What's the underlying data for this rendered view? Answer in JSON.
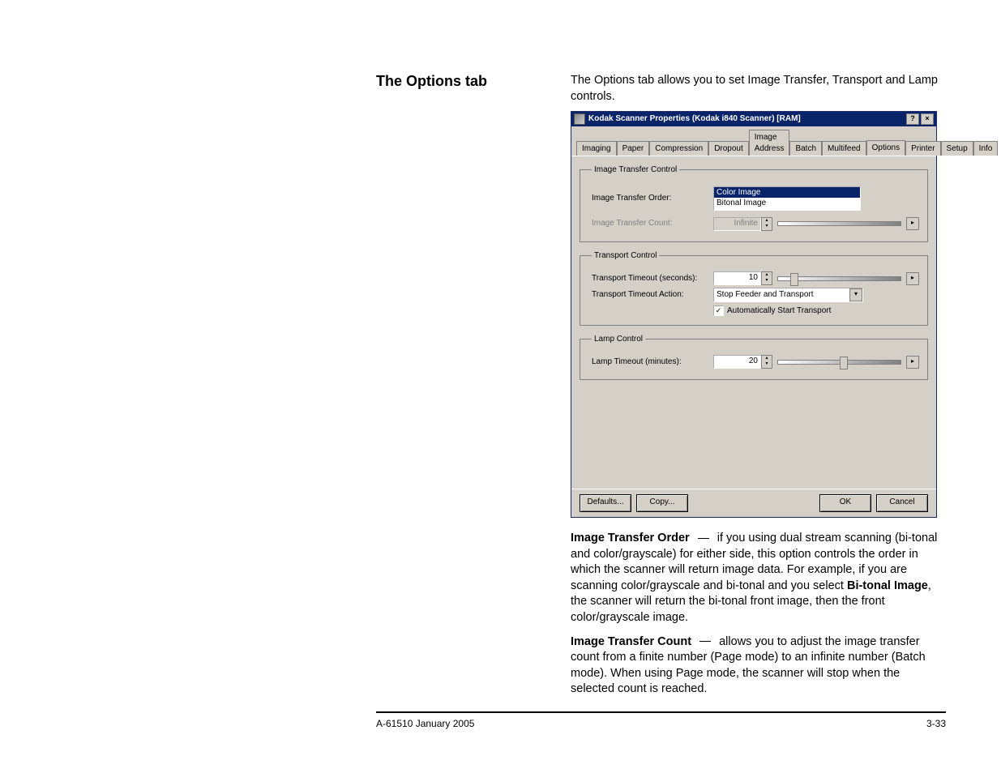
{
  "heading": "The Options tab",
  "intro": "The Options tab allows you to set Image Transfer, Transport and Lamp controls.",
  "dialog": {
    "title": "Kodak Scanner Properties (Kodak i840 Scanner) [RAM]",
    "help_btn": "?",
    "close_btn": "×",
    "tabs": [
      "Imaging",
      "Paper",
      "Compression",
      "Dropout",
      "Image Address",
      "Batch",
      "Multifeed",
      "Options",
      "Printer",
      "Setup",
      "Info"
    ],
    "active_tab": "Options",
    "grp_image_transfer": "Image Transfer Control",
    "lbl_order": "Image Transfer Order:",
    "order_items": [
      "Color Image",
      "Bitonal Image"
    ],
    "order_selected": "Color Image",
    "lbl_count": "Image Transfer Count:",
    "count_value": "Infinite",
    "grp_transport": "Transport Control",
    "lbl_tt_seconds": "Transport Timeout (seconds):",
    "tt_seconds_value": "10",
    "lbl_tt_action": "Transport Timeout Action:",
    "tt_action_value": "Stop Feeder and Transport",
    "chk_auto_start": "Automatically Start Transport",
    "grp_lamp": "Lamp Control",
    "lbl_lamp_timeout": "Lamp Timeout (minutes):",
    "lamp_timeout_value": "20",
    "btn_defaults": "Defaults...",
    "btn_copy": "Copy...",
    "btn_ok": "OK",
    "btn_cancel": "Cancel"
  },
  "para1": {
    "lead": "Image Transfer Order",
    "text_a": " if you using dual stream scanning (bi-tonal and color/grayscale) for either side, this option controls the order in which the scanner will return image data. For example, if you are scanning color/grayscale and bi-tonal and you select ",
    "bold": "Bi-tonal Image",
    "text_b": ", the scanner will return the bi-tonal front image, then the front color/grayscale image."
  },
  "para2": {
    "lead": "Image Transfer Count",
    "text": " allows you to adjust the image transfer count from a finite number (Page mode) to an infinite number (Batch mode). When using Page mode, the scanner will stop when the selected count is reached."
  },
  "footer_left": "A-61510 January 2005",
  "footer_right": "3-33"
}
